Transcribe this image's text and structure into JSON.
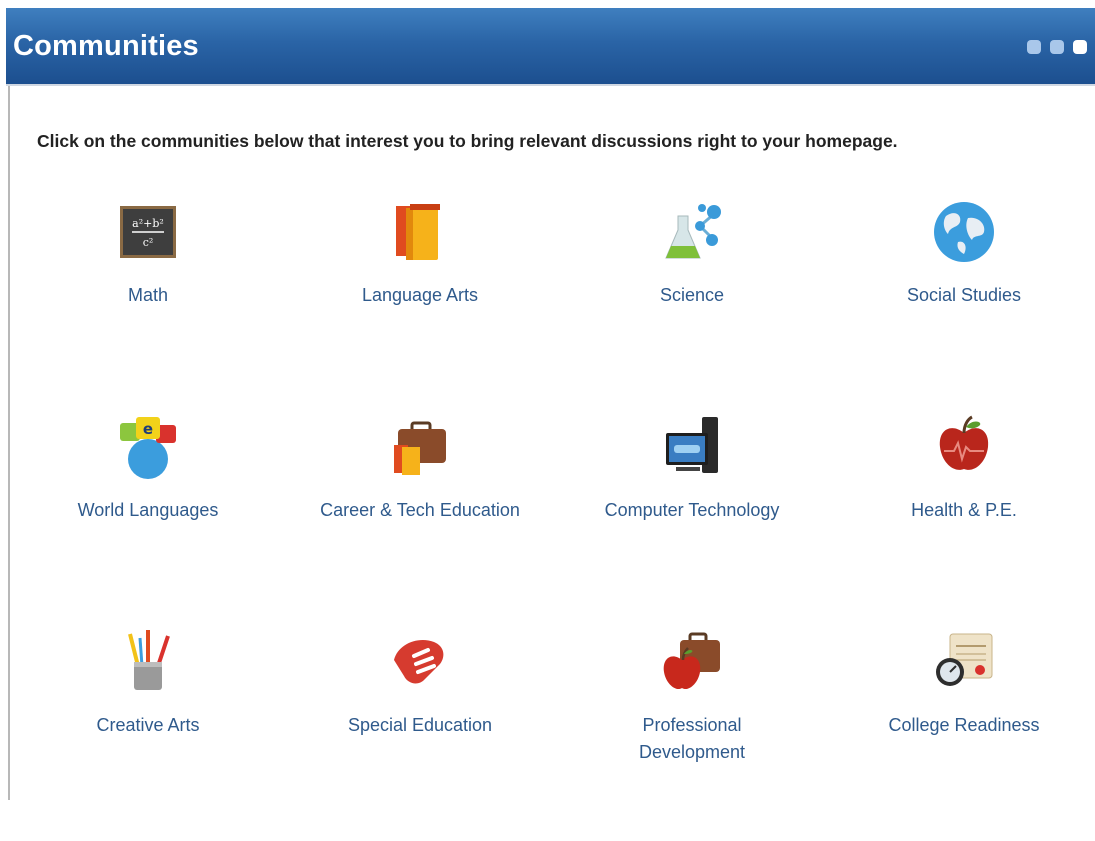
{
  "header": {
    "title": "Communities",
    "pagination": [
      false,
      false,
      true
    ]
  },
  "intro": "Click on the communities below that interest you to bring relevant discussions right to your homepage.",
  "communities": [
    {
      "label": "Math",
      "icon": "chalkboard-formula-icon"
    },
    {
      "label": "Language Arts",
      "icon": "books-icon"
    },
    {
      "label": "Science",
      "icon": "flask-molecule-icon"
    },
    {
      "label": "Social Studies",
      "icon": "globe-icon"
    },
    {
      "label": "World Languages",
      "icon": "speech-bubbles-globe-icon"
    },
    {
      "label": "Career & Tech Education",
      "icon": "briefcase-books-icon"
    },
    {
      "label": "Computer Technology",
      "icon": "computer-monitor-icon"
    },
    {
      "label": "Health & P.E.",
      "icon": "apple-heartbeat-icon"
    },
    {
      "label": "Creative Arts",
      "icon": "paint-brushes-icon"
    },
    {
      "label": "Special Education",
      "icon": "helping-hands-icon"
    },
    {
      "label": "Professional Development",
      "icon": "apple-briefcase-icon"
    },
    {
      "label": "College Readiness",
      "icon": "diploma-compass-icon"
    }
  ]
}
